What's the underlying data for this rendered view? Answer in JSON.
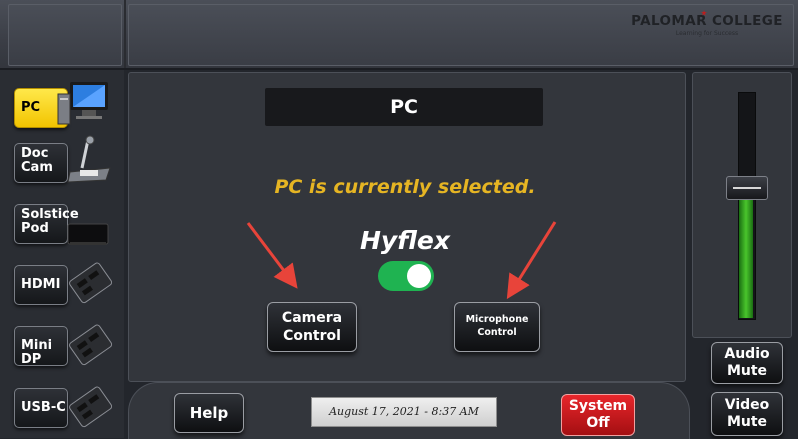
{
  "header": {
    "logo_title": "PALOMAR COLLEGE",
    "logo_tagline": "Learning for Success"
  },
  "sources": [
    {
      "label": "PC",
      "icon": "computer-icon",
      "active": true
    },
    {
      "label": "Doc Cam",
      "icon": "document-camera-icon",
      "active": false
    },
    {
      "label": "Solstice Pod",
      "icon": "solstice-pod-icon",
      "active": false
    },
    {
      "label": "HDMI",
      "icon": "hdmi-plate-icon",
      "active": false
    },
    {
      "label": "Mini DP",
      "icon": "mini-dp-plate-icon",
      "active": false
    },
    {
      "label": "USB-C",
      "icon": "usb-c-plate-icon",
      "active": false
    }
  ],
  "main": {
    "title": "PC",
    "status": "PC is currently selected.",
    "hyflex_label": "Hyflex",
    "hyflex_on": true,
    "camera_control_label": [
      "Camera",
      "Control"
    ],
    "microphone_control_label": [
      "Microphone",
      "Control"
    ]
  },
  "footer": {
    "help_label": "Help",
    "datetime": "August 17, 2021 - 8:37 AM",
    "system_off_label": [
      "System",
      "Off"
    ]
  },
  "volume": {
    "level_percent": 52,
    "audio_mute_label": [
      "Audio",
      "Mute"
    ],
    "video_mute_label": [
      "Video",
      "Mute"
    ]
  },
  "colors": {
    "active_yellow": "#f5d100",
    "status_text": "#e6b523",
    "toggle_green": "#1fb351",
    "system_off_red": "#d61c20",
    "volume_green": "#3fbf2a",
    "arrow_red": "#e8443a"
  }
}
